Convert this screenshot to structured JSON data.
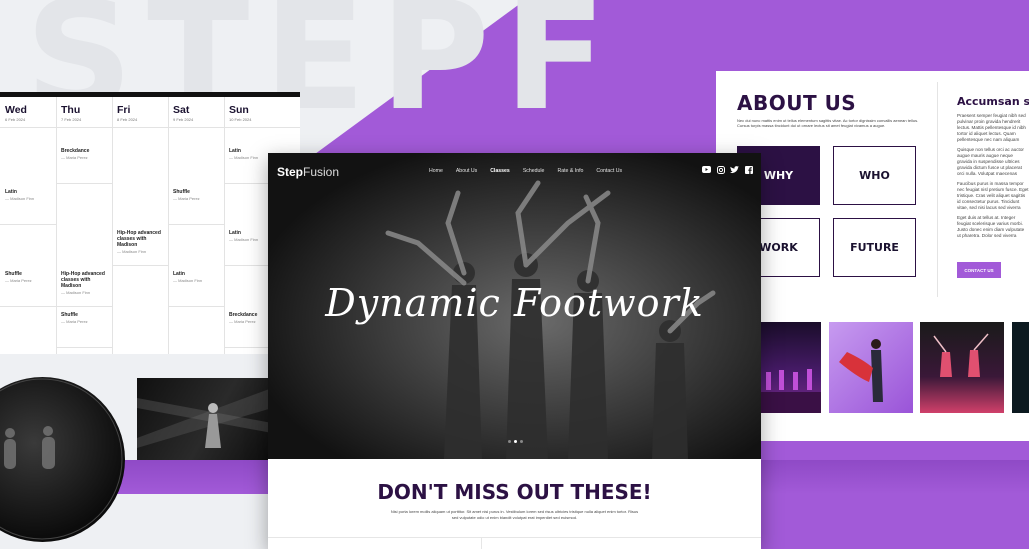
{
  "watermark": "STEPF",
  "colors": {
    "accent": "#a25ad8",
    "dark_purple": "#2c1144"
  },
  "schedule": {
    "days": [
      {
        "name": "Wed",
        "date": "6 Feb 2024"
      },
      {
        "name": "Thu",
        "date": "7 Feb 2024"
      },
      {
        "name": "Fri",
        "date": "8 Feb 2024"
      },
      {
        "name": "Sat",
        "date": "9 Feb 2024"
      },
      {
        "name": "Sun",
        "date": "10 Feb 2024"
      }
    ],
    "classes": {
      "thu_1": {
        "title": "Breckdance",
        "teacher": "— Maria Perez"
      },
      "sun_1": {
        "title": "Latin",
        "teacher": "— Madison Finn"
      },
      "wed_2": {
        "title": "Latin",
        "teacher": "— Madison Finn"
      },
      "sat_2": {
        "title": "Shuffle",
        "teacher": "— Maria Perez"
      },
      "fri_3": {
        "title": "Hip-Hop advanced classes with Madison",
        "teacher": "— Madison Finn"
      },
      "sun_3": {
        "title": "Latin",
        "teacher": "— Madison Finn"
      },
      "wed_4": {
        "title": "Shuffle",
        "teacher": "— Maria Perez"
      },
      "thu_4": {
        "title": "Hip-Hop advanced classes with Madison",
        "teacher": "— Madison Finn"
      },
      "sat_4": {
        "title": "Latin",
        "teacher": "— Madison Finn"
      },
      "thu_5": {
        "title": "Shuffle",
        "teacher": "— Maria Perez"
      },
      "sun_5": {
        "title": "Breckdance",
        "teacher": "— Maria Perez"
      }
    }
  },
  "hero": {
    "logo_bold": "Step",
    "logo_light": "Fusion",
    "menu": [
      "Home",
      "About Us",
      "Classes",
      "Schedule",
      "Rate & Info",
      "Contact Us"
    ],
    "active_menu": "Classes",
    "socials": [
      "youtube-icon",
      "instagram-icon",
      "twitter-icon",
      "facebook-icon"
    ],
    "title": "Dynamic Footwork",
    "cta_title": "DON'T MISS OUT THESE!",
    "cta_text": "Nisi porta lorem mollis aliquam ut porttitor. Sit amet nisl purus in. Vestibulum lorem sed risus ultricies tristique nulla aliquet enim tortor. Risus sed vulputate odio ut enim blandit volutpat erat imperdiet sed euismod."
  },
  "about": {
    "title": "ABOUT US",
    "text": "Nec dui nunc mattis enim ut tellus elementum sagittis vitae. Ac tortor dignissim convallis aenean tellus. Cursus turpis massa tincidunt dui ut ornare lectus sit amet feugiat vivamus a augue.",
    "boxes": [
      "WHY",
      "WHO",
      "WORK",
      "FUTURE"
    ],
    "acc_title": "Accumsan sit",
    "acc_p1": "Praesent semper feugiat nibh sed pulvinar proin gravida hendrerit lectus. Mattis pellentesque id nibh tortor id aliquet lectus. Quam pellentesque nec nam aliquam sem. Elementum curabitur vitae nunc sed velit.",
    "acc_p2": "Quisque non tellus orci ac auctor augue mauris augue neque gravida in suspendisse ultrices gravida dictum fusce ut placerat orci nulla. Volutpat maecenas volutpat blandit aliquam etiam erat velit. Id aliquet sagittis orci a scelerisque purus semper.",
    "acc_p3": "Faucibus purus in massa tempor nec feugiat nisl pretium fusce. Eget tristique. Cras velit aliquet sagittis id consectetur purus. Tincidunt vitae, sed nisi lacus sed viverra tellus in hac habitasse congue eu. Auctor eu augue ut lectus arcu bibendum.",
    "acc_p4": "Eget duis at tellus at. Integer feugiat scelerisque varius morbi. Justo donec enim diam vulputate ut pharetra. Dolor sed viverra ipsum sed ullamcorper morbi tincidunt ornare massa eget.",
    "contact_label": "CONTACT US"
  }
}
